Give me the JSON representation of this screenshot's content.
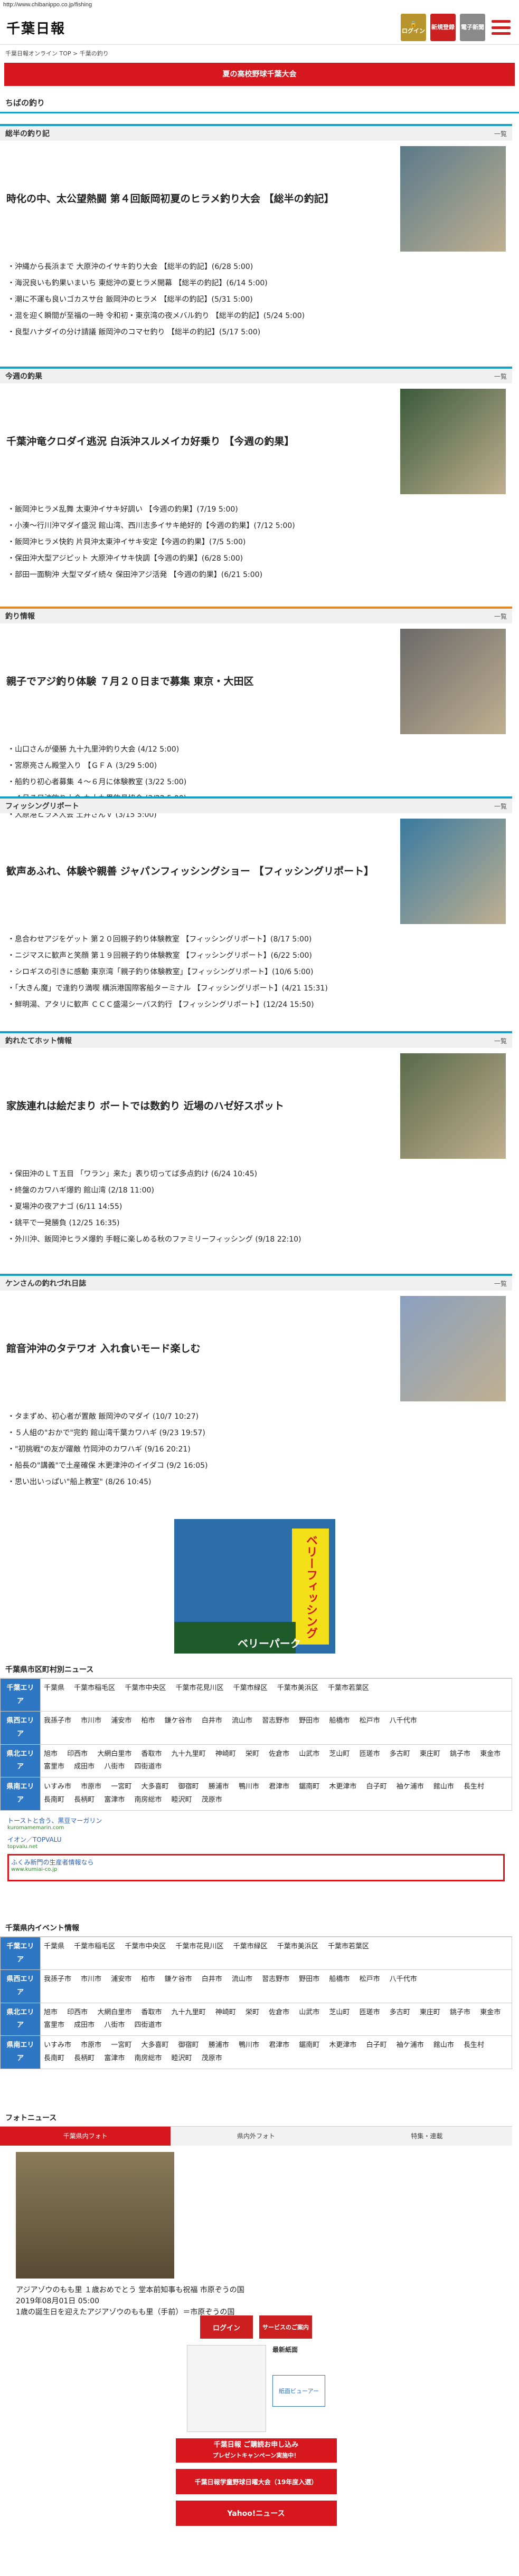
{
  "url": "http://www.chibanippo.co.jp/fishing",
  "header": {
    "logo": "千葉日報",
    "btn_login": "ログイン",
    "btn_register": "新規登録",
    "btn_paper": "電子新聞"
  },
  "breadcrumb": "千葉日報オンライン TOP > 千葉の釣り",
  "banner": "夏の高校野球千葉大会",
  "page_title": "ちばの釣り",
  "more_label": "一覧",
  "sections": [
    {
      "title": "総半の釣り記",
      "feature": "時化の中、太公望熱闘 第４回飯岡初夏のヒラメ釣り大会 【総半の釣記】",
      "items": [
        "沖縄から長浜まで 大原沖のイサキ釣り大会 【総半の釣記】(6/28 5:00)",
        "海況良いも釣果いまいち 東総沖の夏ヒラメ開幕 【総半の釣記】(6/14 5:00)",
        "潮に不運も良いゴカスサ台 飯岡沖のヒラメ 【総半の釣記】(5/31 5:00)",
        "混を迎く瞬間が至福の一時 令和初・東京湾の夜メバル釣り 【総半の釣記】(5/24 5:00)",
        "良型ハナダイの分け請議 飯岡沖のコマセ釣り 【総半の釣記】(5/17 5:00)"
      ]
    },
    {
      "title": "今週の釣果",
      "feature": "千葉沖竜クロダイ逃況 白浜沖スルメイカ好乗り 【今週の釣果】",
      "items": [
        "飯岡沖ヒラメ乱舞 太東沖イサキ好調い 【今週の釣果】(7/19 5:00)",
        "小湊～行川沖マダイ盛況 館山湾、西川志多イサキ絶好的【今週の釣果】(7/12 5:00)",
        "飯岡沖ヒラメ快釣 片貝沖太東沖イサキ安定【今週の釣果】(7/5 5:00)",
        "保田沖大型アジピット 大原沖イサキ快調【今週の釣果】(6/28 5:00)",
        "部田一面駒沖 大型マダイ続々 保田沖アジ活発 【今週の釣果】(6/21 5:00)"
      ]
    },
    {
      "title": "釣り情報",
      "feature": "親子でアジ釣り体験 ７月２０日まで募集 東京・大田区",
      "items": [
        "山口さんが優勝 九十九里沖釣り大会 (4/12 5:00)",
        "宮原亮さん殿堂入り 【ＧＦＡ (3/29 5:00)",
        "船釣り初心者募集 ４～６月に体験教室 (3/22 5:00)",
        "４月７日沖釣り大会 九十九里釣具協会 (3/22 5:00)",
        "大原港ヒラメ大会 土井さんＶ (3/15 5:00)"
      ]
    },
    {
      "title": "フィッシングリポート",
      "feature": "歓声あふれ、体験や親善 ジャパンフィッシングショー 【フィッシングリポート】",
      "items": [
        "息合わせアジをゲット 第２０回親子釣り体験教室 【フィッシングリポート】(8/17 5:00)",
        "ニジマスに歓声と笑顔 第１９回親子釣り体験教室 【フィッシングリポート】(6/22 5:00)",
        "シロギスの引きに感動 東京湾「親子釣り体験教室」【フィッシングリポート】(10/6 5:00)",
        "「大きん魔」で逢釣り満喫 構浜港国際客船ターミナル 【フィッシングリポート】(4/21 15:31)",
        "鮮明湯、アタリに歓声 ＣＣＣ盛湯シーバス釣行 【フィッシングリポート】(12/24 15:50)"
      ]
    },
    {
      "title": "釣れたてホット情報",
      "feature": "家族連れは絵だまり ボートでは数釣り 近場のハゼ好スポット",
      "items": [
        "保田沖のＬＴ五目 「ワラン」来た」表り切ってば多点釣け (6/24 10:45)",
        "終盤のカワハギ爆釣 館山湾 (2/18 11:00)",
        "夏場沖の夜アナゴ (6/11 14:55)",
        "銚平で一発勝負 (12/25 16:35)",
        "外川沖、飯岡沖ヒラメ爆釣 手軽に楽しめる秋のファミリーフィッシング (9/18 22:10)"
      ]
    },
    {
      "title": "ケンさんの釣れづれ日誌",
      "feature": "館音沖沖のタテワオ 入れ食いモード楽しむ",
      "items": [
        "タまずめ、初心者が置敵 飯岡沖のマダイ (10/7 10:27)",
        "５人組の\"おかで\"完釣 館山湾千葉カワハギ (9/23 19:57)",
        "\"初挑戦\"の友が躍敵 竹岡沖のカワハギ (9/16 20:21)",
        "船長の\"講義\"で土産確保 木更津沖のイイダコ (9/2 16:05)",
        "思い出いっぱい\"船上教室\" (8/26 10:45)"
      ]
    }
  ],
  "ad_1": {
    "text": "ベリーフィッシング",
    "sub": "ベリーパーク"
  },
  "area_news": {
    "title": "千葉県市区町村別ニュース",
    "rows": [
      {
        "label": "千葉エリア",
        "cities": [
          "千葉県",
          "千葉市稲毛区",
          "千葉市中央区",
          "千葉市花見川区",
          "千葉市緑区",
          "千葉市美浜区",
          "千葉市若葉区"
        ]
      },
      {
        "label": "県西エリア",
        "cities": [
          "我孫子市",
          "市川市",
          "浦安市",
          "柏市",
          "鎌ケ谷市",
          "白井市",
          "流山市",
          "習志野市",
          "野田市",
          "船橋市",
          "松戸市",
          "八千代市"
        ]
      },
      {
        "label": "県北エリア",
        "cities": [
          "旭市",
          "印西市",
          "大網白里市",
          "香取市",
          "九十九里町",
          "神崎町",
          "栄町",
          "佐倉市",
          "山武市",
          "芝山町",
          "匝瑳市",
          "多古町",
          "東庄町",
          "銚子市",
          "東金市",
          "富里市",
          "成田市",
          "八街市",
          "四街道市"
        ]
      },
      {
        "label": "県南エリア",
        "cities": [
          "いすみ市",
          "市原市",
          "一宮町",
          "大多喜町",
          "御宿町",
          "勝浦市",
          "鴨川市",
          "君津市",
          "鋸南町",
          "木更津市",
          "白子町",
          "袖ケ浦市",
          "館山市",
          "長生村",
          "長南町",
          "長柄町",
          "富津市",
          "南房総市",
          "睦沢町",
          "茂原市"
        ]
      }
    ]
  },
  "ads_text": [
    {
      "title": "トーストと合う、黒豆マーガリン",
      "url": "kuromamemarin.com"
    },
    {
      "title": "イオン／TOPVALU",
      "url": "topvalu.net"
    },
    {
      "title": "ふくみ新門の生産者情報なら",
      "url": "www.kumiai-co.jp"
    }
  ],
  "event_news": {
    "title": "千葉県内イベント情報"
  },
  "photo_news": {
    "title": "フォトニュース",
    "tabs": [
      "千葉県内フォト",
      "県内外フォト",
      "特集・連載"
    ],
    "caption": "アジアゾウのもも里 １歳おめでとう 堂本前知事も祝福 市原ぞうの国",
    "date": "2019年08月01日 05:00",
    "desc": "1歳の誕生日を迎えたアジアゾウのもも里（手前）＝市原ぞうの国"
  },
  "bottom": {
    "login": "ログイン",
    "service": "サービスのご案内",
    "latest": "最新紙面",
    "viewer": "紙面ビューアー",
    "campaign": "千葉日報 ご購読お申し込み",
    "campaign_sub": "プレゼントキャンペーン実施中！",
    "highschool": "千葉日報学童野球日曜大会（19年度入選）",
    "yahoo": "Yahoo!ニュース"
  }
}
